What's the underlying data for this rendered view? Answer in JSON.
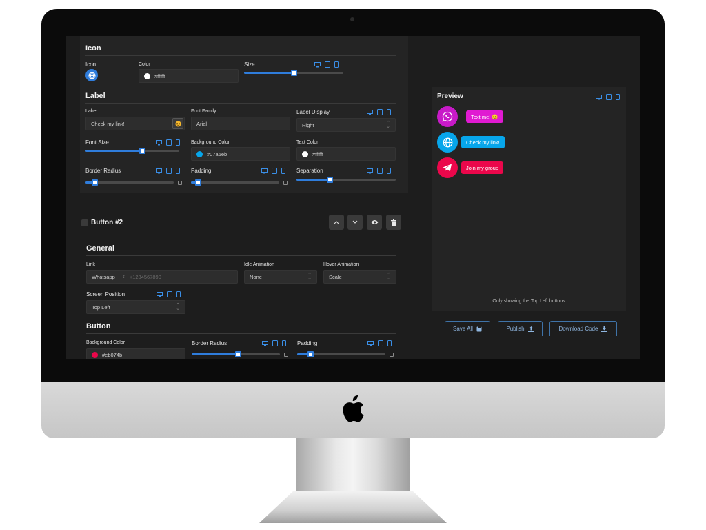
{
  "icon_section": {
    "title": "Icon",
    "icon_label": "Icon",
    "color_label": "Color",
    "color_value": "#ffffff",
    "size_label": "Size",
    "size_value": 0.5
  },
  "label_section": {
    "title": "Label",
    "label_label": "Label",
    "label_value": "Check my link!",
    "font_family_label": "Font Family",
    "font_family_value": "Arial",
    "label_display_label": "Label Display",
    "label_display_value": "Right",
    "font_size_label": "Font Size",
    "font_size_value": 0.6,
    "bg_color_label": "Background Color",
    "bg_color_value": "#07a6eb",
    "text_color_label": "Text Color",
    "text_color_value": "#ffffff",
    "border_radius_label": "Border Radius",
    "border_radius_value": 0.1,
    "padding_label": "Padding",
    "padding_value": 0.08,
    "separation_label": "Separation",
    "separation_value": 0.33
  },
  "button2": {
    "title": "Button #2"
  },
  "general_section": {
    "title": "General",
    "link_label": "Link",
    "link_type": "Whatsapp",
    "link_placeholder": "+1234567890",
    "idle_animation_label": "Idle Animation",
    "idle_animation_value": "None",
    "hover_animation_label": "Hover Animation",
    "hover_animation_value": "Scale",
    "screen_position_label": "Screen Position",
    "screen_position_value": "Top Left"
  },
  "button_section": {
    "title": "Button",
    "bg_color_label": "Background Color",
    "bg_color_value": "#eb074b",
    "border_radius_label": "Border Radius",
    "border_radius_value": 0.52,
    "padding_label": "Padding",
    "padding_value": 0.15
  },
  "preview": {
    "title": "Preview",
    "note": "Only showing the Top Left buttons",
    "buttons": [
      {
        "label": "Text me! 😊",
        "icon_color": "#c81ac8",
        "label_color": "#e01ad2"
      },
      {
        "label": "Check my link!",
        "icon_color": "#07a6eb",
        "label_color": "#07a6eb"
      },
      {
        "label": "Join my group",
        "icon_color": "#eb074b",
        "label_color": "#eb074b"
      }
    ]
  },
  "actions": {
    "save_all": "Save All",
    "publish": "Publish",
    "download_code": "Download Code"
  },
  "colors": {
    "accent": "#2f7ddc",
    "background": "#1d1d1d",
    "card": "#242424"
  }
}
